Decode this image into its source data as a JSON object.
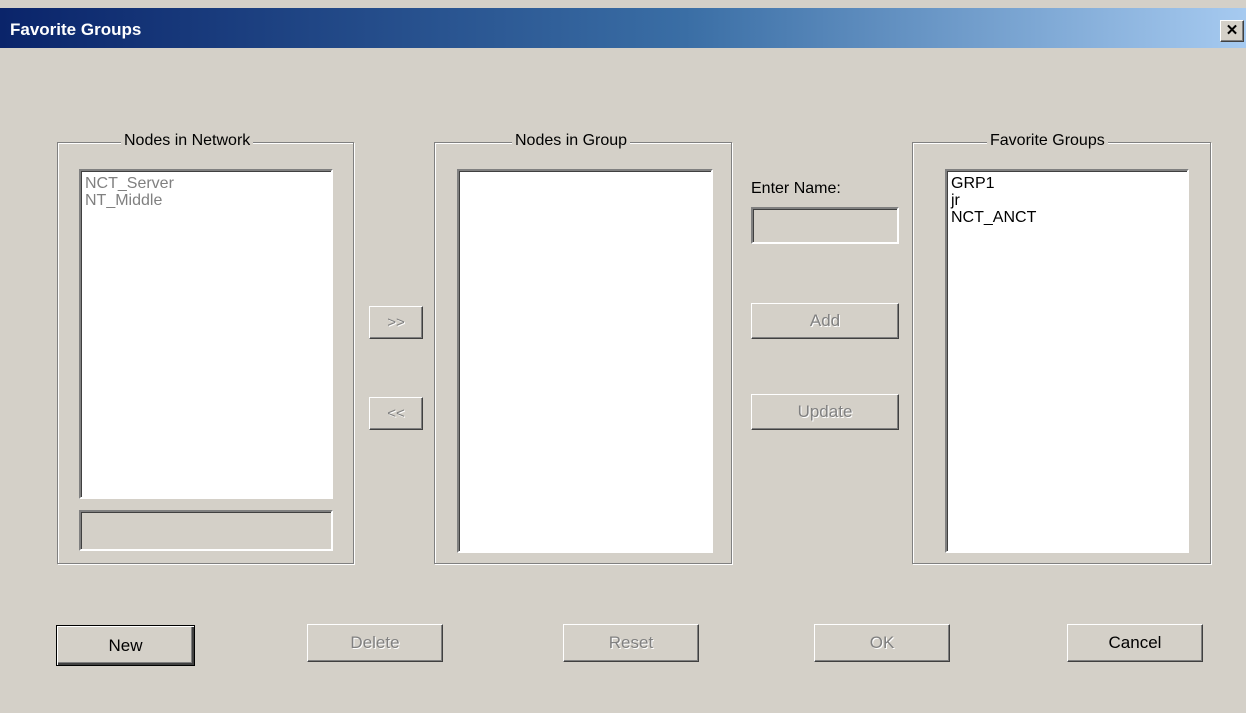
{
  "window": {
    "title": "Favorite Groups",
    "close_glyph": "✕"
  },
  "nodes_in_network": {
    "legend": "Nodes in Network",
    "items": [
      "NCT_Server",
      "NT_Middle"
    ],
    "field_value": ""
  },
  "transfer": {
    "add_label": ">>",
    "remove_label": "<<"
  },
  "nodes_in_group": {
    "legend": "Nodes in Group",
    "items": []
  },
  "name_entry": {
    "label": "Enter Name:",
    "value": "",
    "add_label": "Add",
    "update_label": "Update"
  },
  "favorite_groups": {
    "legend": "Favorite Groups",
    "items": [
      "GRP1",
      "jr",
      "NCT_ANCT"
    ]
  },
  "footer": {
    "new_label": "New",
    "delete_label": "Delete",
    "reset_label": "Reset",
    "ok_label": "OK",
    "cancel_label": "Cancel"
  },
  "colors": {
    "face": "#d4d0c8",
    "title_start": "#0a246a",
    "title_end": "#a6caf0",
    "disabled_text": "#808080"
  }
}
